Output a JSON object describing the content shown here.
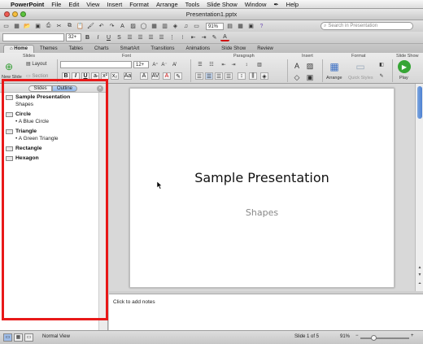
{
  "menubar": {
    "app": "PowerPoint",
    "items": [
      "File",
      "Edit",
      "View",
      "Insert",
      "Format",
      "Arrange",
      "Tools",
      "Slide Show",
      "Window",
      "Help"
    ]
  },
  "window": {
    "title": "Presentation1.pptx"
  },
  "toolbar": {
    "zoom": "91%",
    "search_placeholder": "Search in Presentation",
    "font_size": "32+"
  },
  "ribbon": {
    "tabs": [
      "Home",
      "Themes",
      "Tables",
      "Charts",
      "SmartArt",
      "Transitions",
      "Animations",
      "Slide Show",
      "Review"
    ],
    "active_tab": "Home",
    "groups": {
      "slides": "Slides",
      "font": "Font",
      "paragraph": "Paragraph",
      "insert": "Insert",
      "format": "Format",
      "slide_show": "Slide Show"
    },
    "new_slide": "New Slide",
    "layout": "Layout",
    "section": "Section",
    "font_size": "12+",
    "arrange": "Arrange",
    "quick_styles": "Quick Styles",
    "play": "Play"
  },
  "panel": {
    "tab_slides": "Slides",
    "tab_outline": "Outline",
    "active": "Outline",
    "outline": [
      {
        "title": "Sample Presentation",
        "sub": "Shapes"
      },
      {
        "title": "Circle",
        "sub": "• A Blue Circle"
      },
      {
        "title": "Triangle",
        "sub": "• A Green Triangle"
      },
      {
        "title": "Rectangle",
        "sub": ""
      },
      {
        "title": "Hexagon",
        "sub": ""
      }
    ]
  },
  "slide": {
    "title": "Sample Presentation",
    "subtitle": "Shapes"
  },
  "notes": {
    "placeholder": "Click to add notes"
  },
  "status": {
    "view": "Normal View",
    "slide_position": "Slide 1 of 5",
    "zoom": "91%"
  },
  "colors": {
    "highlight": "#e81919",
    "outline_tab_active": "#8fb6e8",
    "play_green": "#36a535"
  }
}
